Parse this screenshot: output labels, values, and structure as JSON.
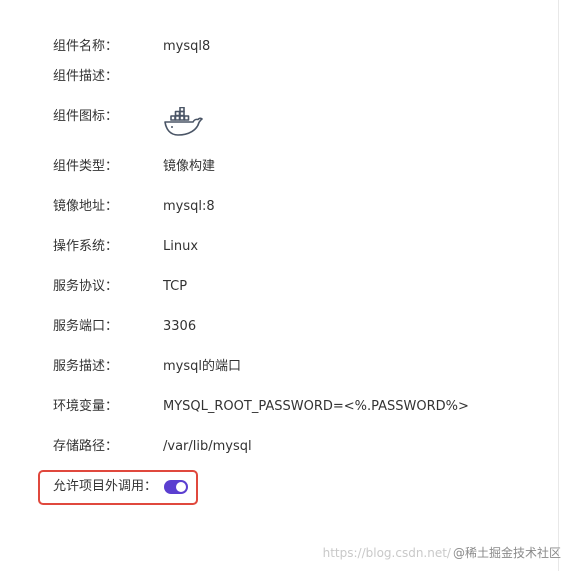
{
  "fields": {
    "name": {
      "label": "组件名称：",
      "value": "mysql8"
    },
    "description": {
      "label": "组件描述：",
      "value": ""
    },
    "icon": {
      "label": "组件图标：",
      "icon": "docker-whale-icon"
    },
    "type": {
      "label": "组件类型：",
      "value": "镜像构建"
    },
    "image": {
      "label": "镜像地址：",
      "value": "mysql:8"
    },
    "os": {
      "label": "操作系统：",
      "value": "Linux"
    },
    "protocol": {
      "label": "服务协议：",
      "value": "TCP"
    },
    "port": {
      "label": "服务端口：",
      "value": "3306"
    },
    "service_desc": {
      "label": "服务描述：",
      "value": "mysql的端口"
    },
    "env": {
      "label": "环境变量：",
      "value": "MYSQL_ROOT_PASSWORD=<%.PASSWORD%>"
    },
    "storage": {
      "label": "存储路径：",
      "value": "/var/lib/mysql"
    },
    "allow_call": {
      "label": "允许项目外调用：",
      "enabled": true
    }
  },
  "watermark": {
    "url": "https://blog.csdn.net/",
    "site": "@稀土掘金技术社区"
  },
  "colors": {
    "toggle_on": "#5b3fd0",
    "highlight_border": "#e0483d",
    "docker_icon": "#4a5566"
  }
}
